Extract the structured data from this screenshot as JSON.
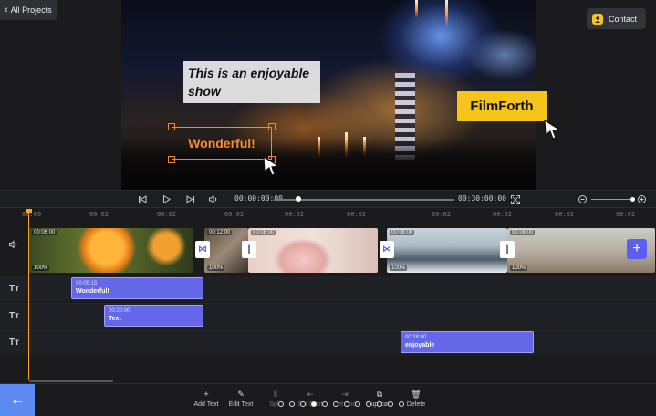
{
  "header": {
    "back_label": "All Projects",
    "contact_label": "Contact"
  },
  "preview": {
    "overlay_caption": "This is an enjoyable show",
    "overlay_brand": "FilmForth",
    "overlay_selected": "Wonderful!"
  },
  "player": {
    "current_time": "00:00:00:00",
    "total_time": "00:30:00:00"
  },
  "ruler": {
    "ticks": [
      "00:00",
      "00:02",
      "00:02",
      "00:02",
      "00:02",
      "00:02",
      "00:02",
      "00:02",
      "00:02",
      "00:02"
    ]
  },
  "video_track": {
    "clips": [
      {
        "time": "00:06:00",
        "volume": "100%"
      },
      {
        "time": "00:12:00",
        "volume": "100%"
      },
      {
        "time": "00:08:00",
        "volume": ""
      },
      {
        "time": "00:08:00",
        "volume": "100%"
      },
      {
        "time": "00:08:00",
        "volume": "100%"
      }
    ]
  },
  "text_tracks": [
    {
      "time": "00:05:15",
      "label": "Wonderful!"
    },
    {
      "time": "00:20:00",
      "label": "Text"
    },
    {
      "time": "00:28:00",
      "label": "enjoyable"
    }
  ],
  "toolbar": {
    "items": [
      {
        "label": "Add Text",
        "icon": "plus-icon"
      },
      {
        "label": "Edit Text",
        "icon": "edit-icon"
      },
      {
        "label": "Split",
        "icon": "split-icon"
      },
      {
        "label": "Set Start",
        "icon": "set-start-icon"
      },
      {
        "label": "Set End",
        "icon": "set-end-icon"
      },
      {
        "label": "Duplicate",
        "icon": "duplicate-icon"
      },
      {
        "label": "Delete",
        "icon": "trash-icon"
      }
    ]
  },
  "colors": {
    "accent": "#6367e8",
    "brand_yellow": "#f5c51c",
    "selection_orange": "#f08a2a",
    "playhead": "#f5a623",
    "back_button": "#5b8af0"
  }
}
